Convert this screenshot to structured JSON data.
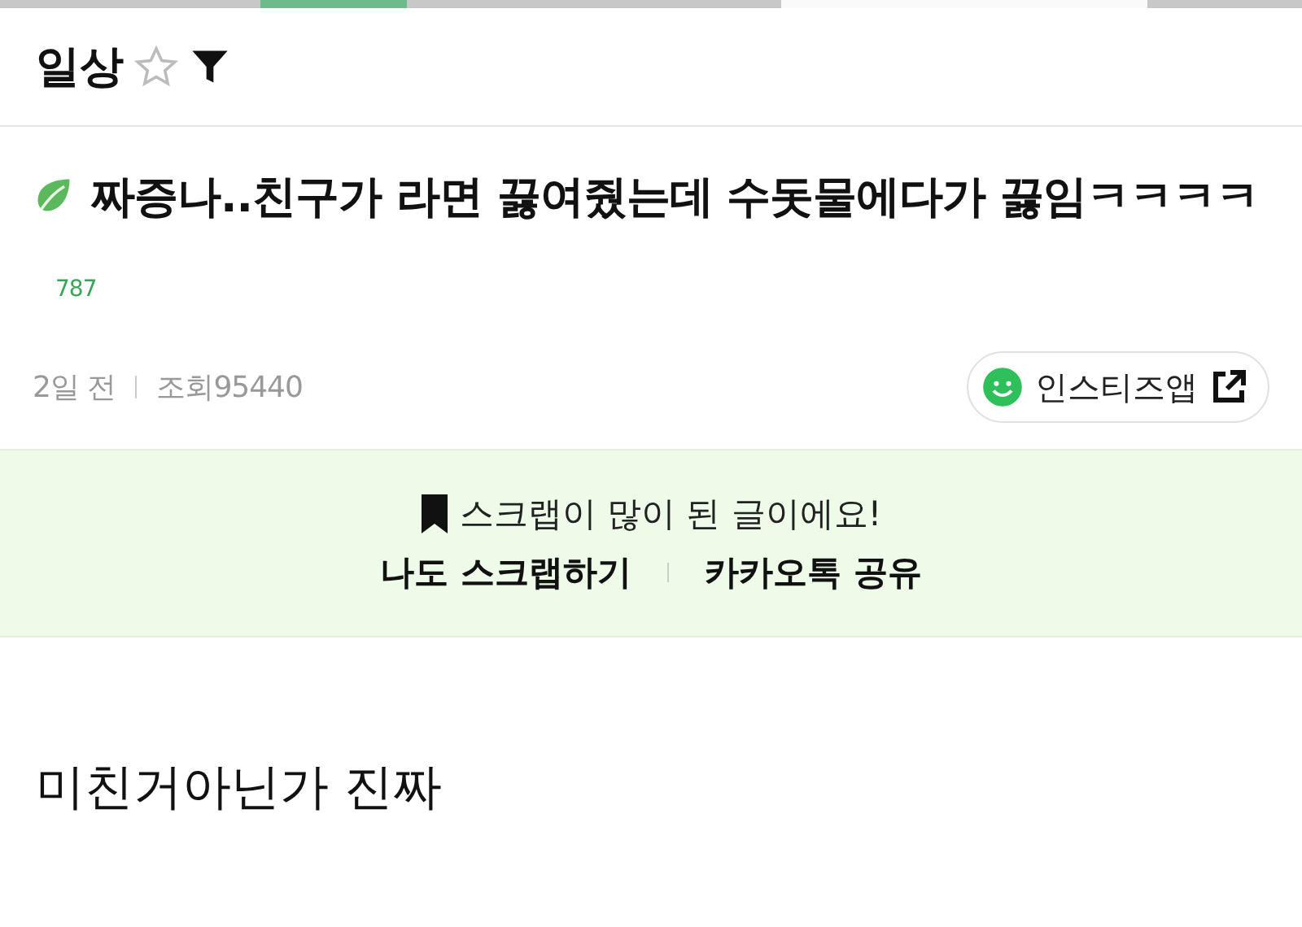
{
  "board": {
    "title": "일상",
    "favorited": false
  },
  "post": {
    "title": "짜증나..친구가 라면 끓여줬는데 수돗물에다가 끓임ㅋㅋㅋㅋ",
    "comment_count": "787",
    "date": "2일 전",
    "views": "조회95440",
    "app_button": "인스티즈앱"
  },
  "scrap_banner": {
    "message": "스크랩이 많이 된 글이에요!",
    "actions": [
      "나도 스크랩하기",
      "카카오톡 공유"
    ]
  },
  "body": {
    "text": "미친거아닌가 진짜"
  }
}
